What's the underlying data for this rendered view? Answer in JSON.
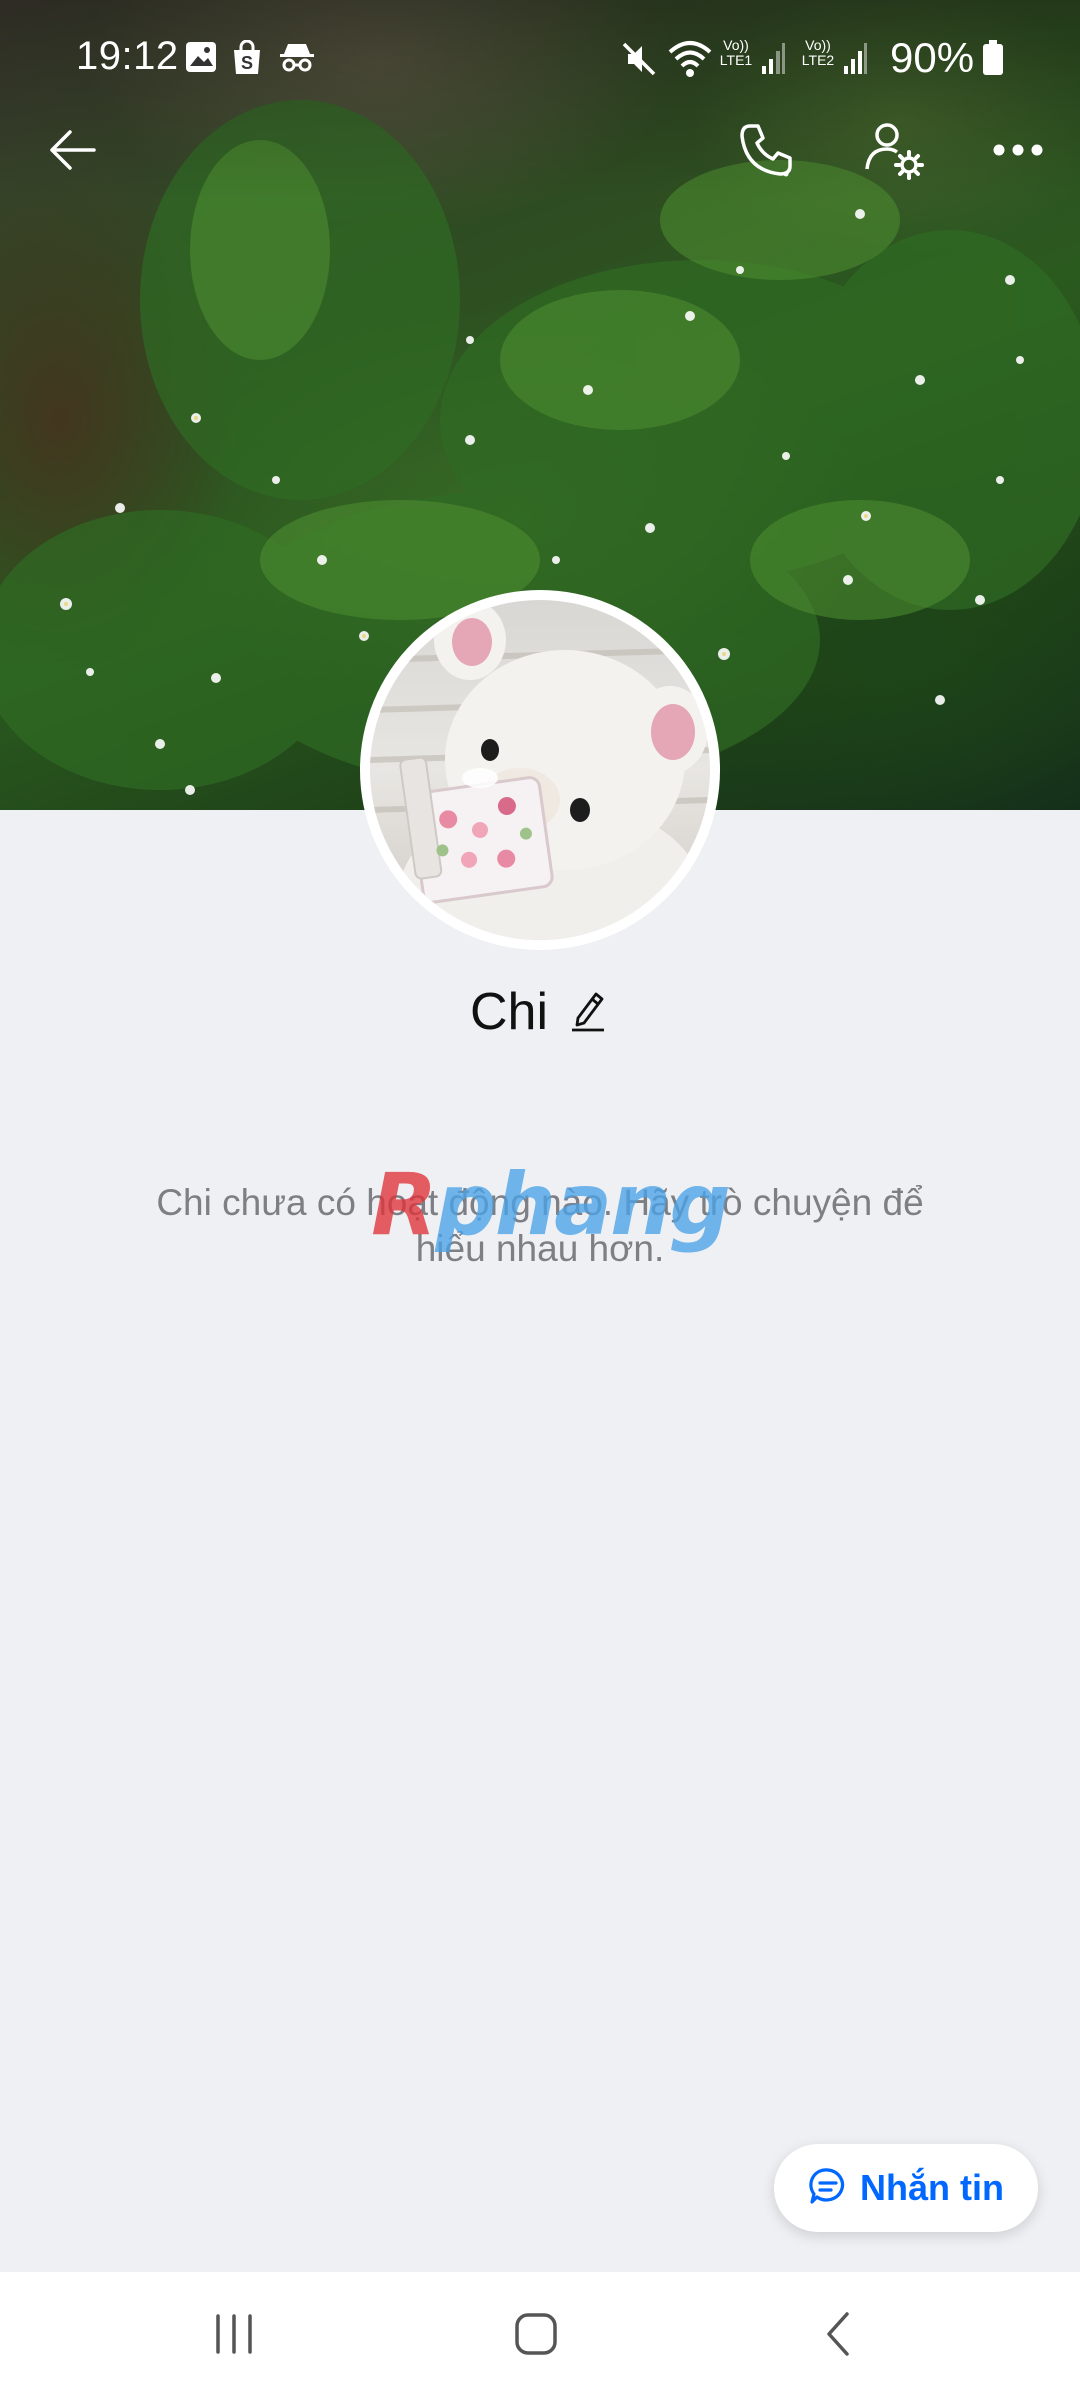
{
  "status_bar": {
    "time": "19:12",
    "battery": "90%",
    "sim1_label": "LTE1",
    "sim2_label": "LTE2",
    "volte_label": "Vo))",
    "icons": [
      "image-icon",
      "shop-icon",
      "incognito-icon",
      "mute-icon",
      "wifi-icon",
      "signal-icon",
      "battery-icon"
    ]
  },
  "app_bar": {
    "icons": [
      "back-arrow-icon",
      "phone-icon",
      "user-settings-icon",
      "more-icon"
    ]
  },
  "profile": {
    "name": "Chi",
    "empty_message": "Chi chưa có hoạt động nào. Hãy trò chuyện để hiểu nhau hơn."
  },
  "watermark": {
    "first": "R",
    "rest": "phang"
  },
  "message_button": {
    "label": "Nhắn tin",
    "icon": "chat-bubble-icon"
  },
  "nav_bar": {
    "icons": [
      "recent-apps-icon",
      "home-icon",
      "nav-back-icon"
    ]
  },
  "colors": {
    "accent": "#0068ff",
    "background": "#eff0f4",
    "watermark_red": "#e0333a",
    "watermark_blue": "#4aa3e8"
  }
}
